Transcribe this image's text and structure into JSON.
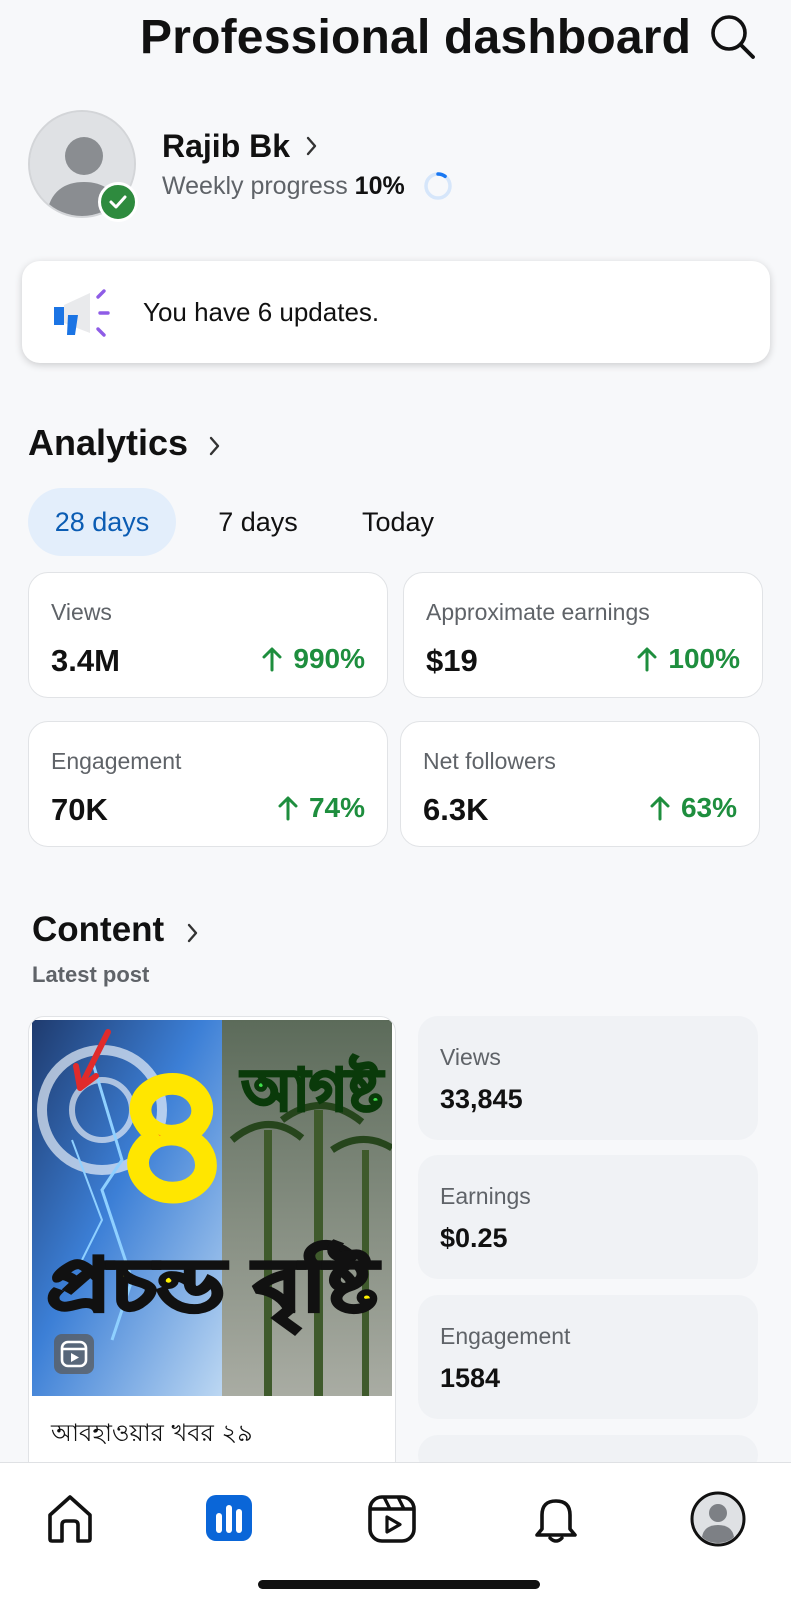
{
  "header": {
    "title": "Professional dashboard",
    "search_icon": "search-icon"
  },
  "profile": {
    "name": "Rajib Bk",
    "progress_label": "Weekly progress",
    "progress_value": "10%",
    "progress_fraction": 0.1,
    "verified_color": "#2e8b3e"
  },
  "updates": {
    "text": "You have 6 updates.",
    "icon": "megaphone-icon"
  },
  "analytics": {
    "title": "Analytics",
    "tabs": [
      {
        "label": "28 days",
        "active": true
      },
      {
        "label": "7 days",
        "active": false
      },
      {
        "label": "Today",
        "active": false
      }
    ],
    "cards": [
      {
        "label": "Views",
        "value": "3.4M",
        "change": "990%"
      },
      {
        "label": "Approximate earnings",
        "value": "$19",
        "change": "100%"
      },
      {
        "label": "Engagement",
        "value": "70K",
        "change": "74%"
      },
      {
        "label": "Net followers",
        "value": "6.3K",
        "change": "63%"
      }
    ]
  },
  "content": {
    "title": "Content",
    "subtitle": "Latest post",
    "post": {
      "caption": "আবহাওয়ার খবর ২৯",
      "thumb_number": "৪",
      "thumb_line1": "আগষ্ট",
      "thumb_line2": "প্রচন্ড বৃষ্টি"
    },
    "metrics": [
      {
        "label": "Views",
        "value": "33,845"
      },
      {
        "label": "Earnings",
        "value": "$0.25"
      },
      {
        "label": "Engagement",
        "value": "1584"
      }
    ]
  },
  "nav": {
    "items": [
      {
        "name": "home-icon",
        "active": false
      },
      {
        "name": "insights-icon",
        "active": true
      },
      {
        "name": "reels-icon",
        "active": false
      },
      {
        "name": "notifications-icon",
        "active": false
      },
      {
        "name": "profile-icon",
        "active": false
      }
    ]
  },
  "colors": {
    "accent": "#0a66d8",
    "positive": "#1e8e3e",
    "tab_active_bg": "#e3eefb"
  }
}
